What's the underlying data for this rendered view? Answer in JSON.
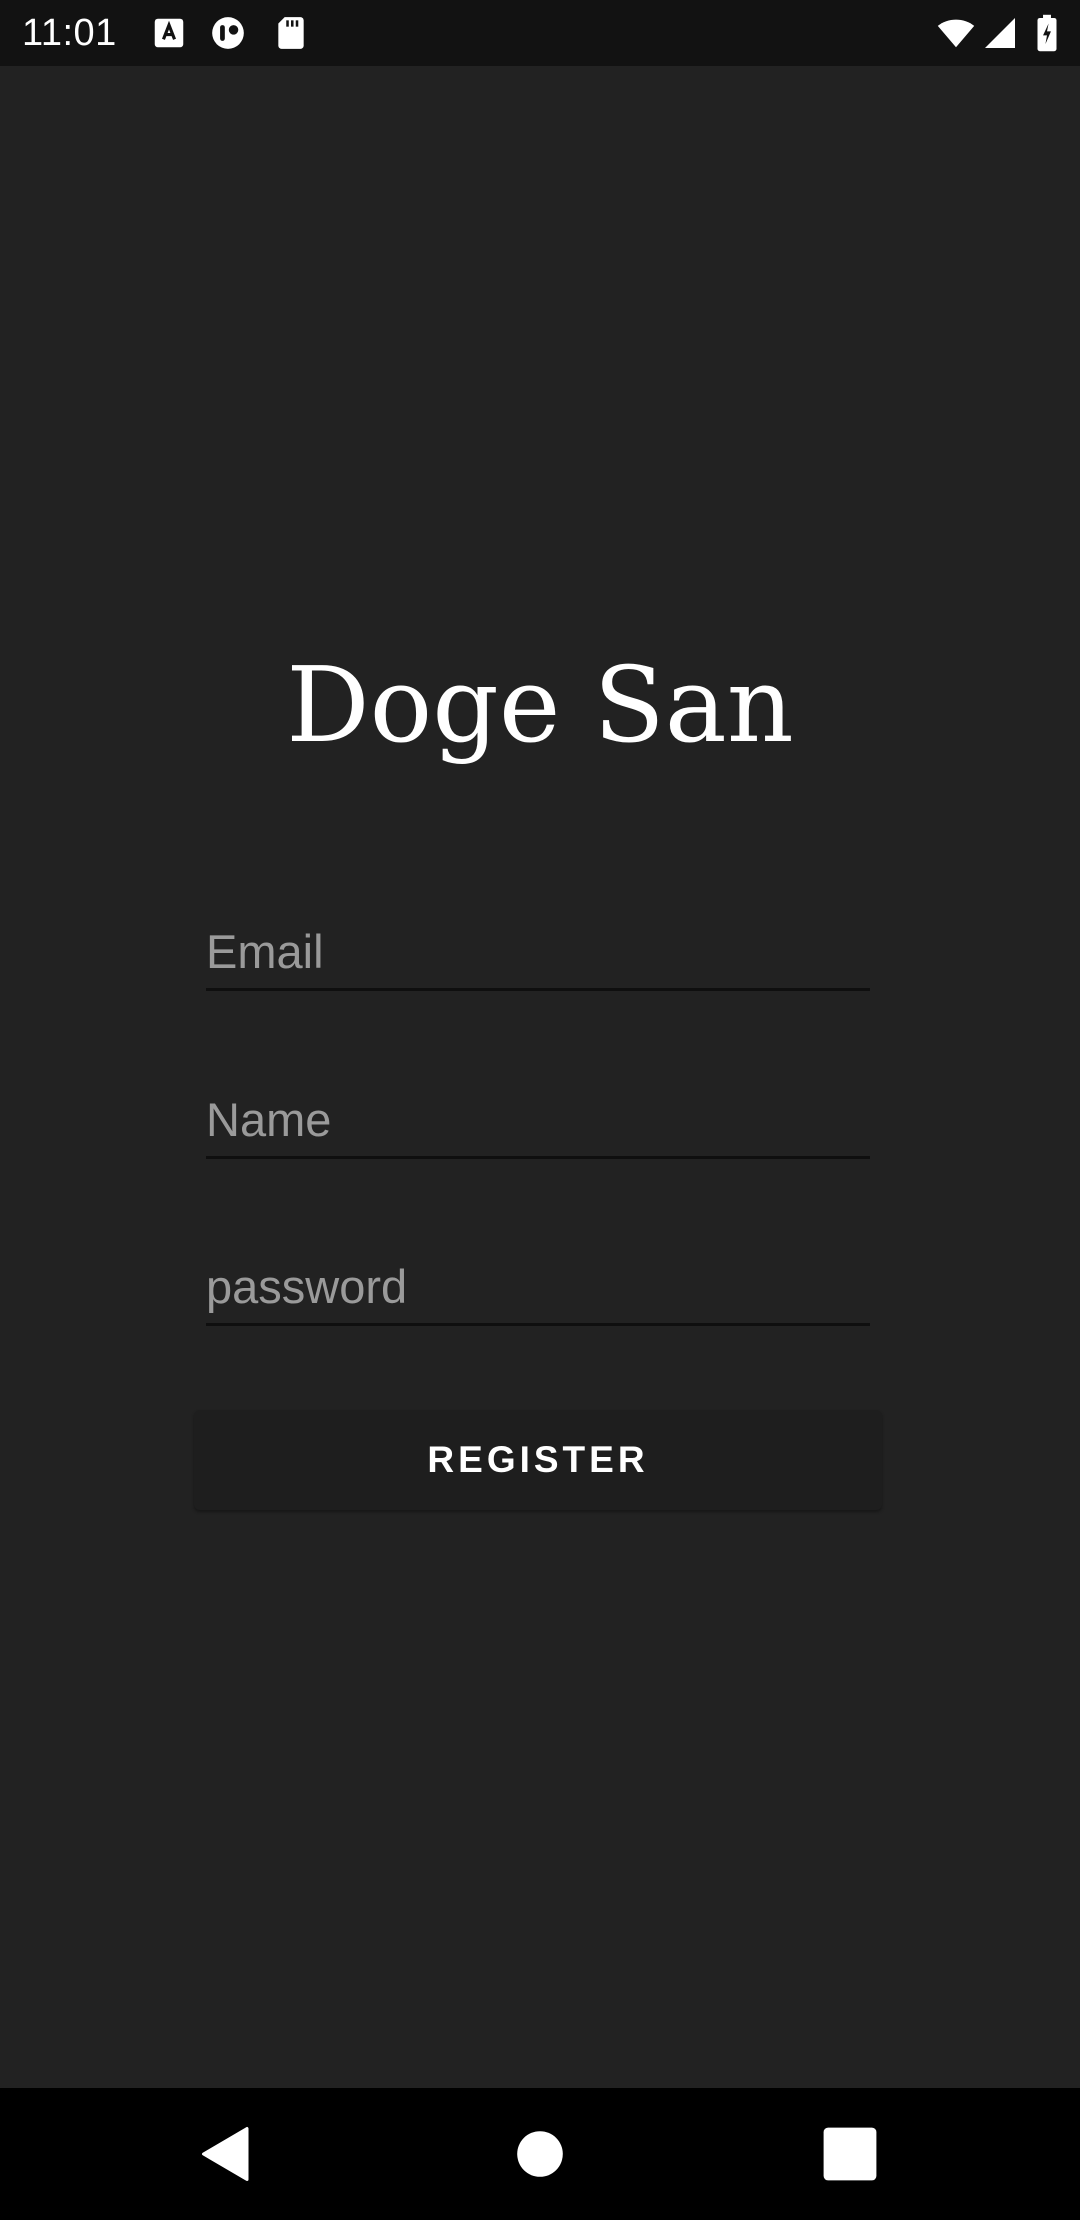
{
  "status_bar": {
    "time": "11:01",
    "left_icons": [
      "a-notification-icon",
      "app-notification-icon",
      "sd-card-icon"
    ],
    "right_icons": [
      "wifi-icon",
      "cellular-signal-icon",
      "battery-charging-icon"
    ]
  },
  "app": {
    "title": "Doge San"
  },
  "form": {
    "email": {
      "value": "",
      "placeholder": "Email"
    },
    "name": {
      "value": "",
      "placeholder": "Name"
    },
    "password": {
      "value": "",
      "placeholder": "password"
    },
    "register_label": "REGISTER"
  },
  "nav_bar": {
    "buttons": [
      "back-icon",
      "home-icon",
      "recents-icon"
    ]
  },
  "colors": {
    "background": "#222222",
    "status_bar": "#121212",
    "nav_bar": "#000000",
    "button": "#1e1e1e",
    "text": "#ffffff",
    "placeholder": "#9a9a9a"
  }
}
